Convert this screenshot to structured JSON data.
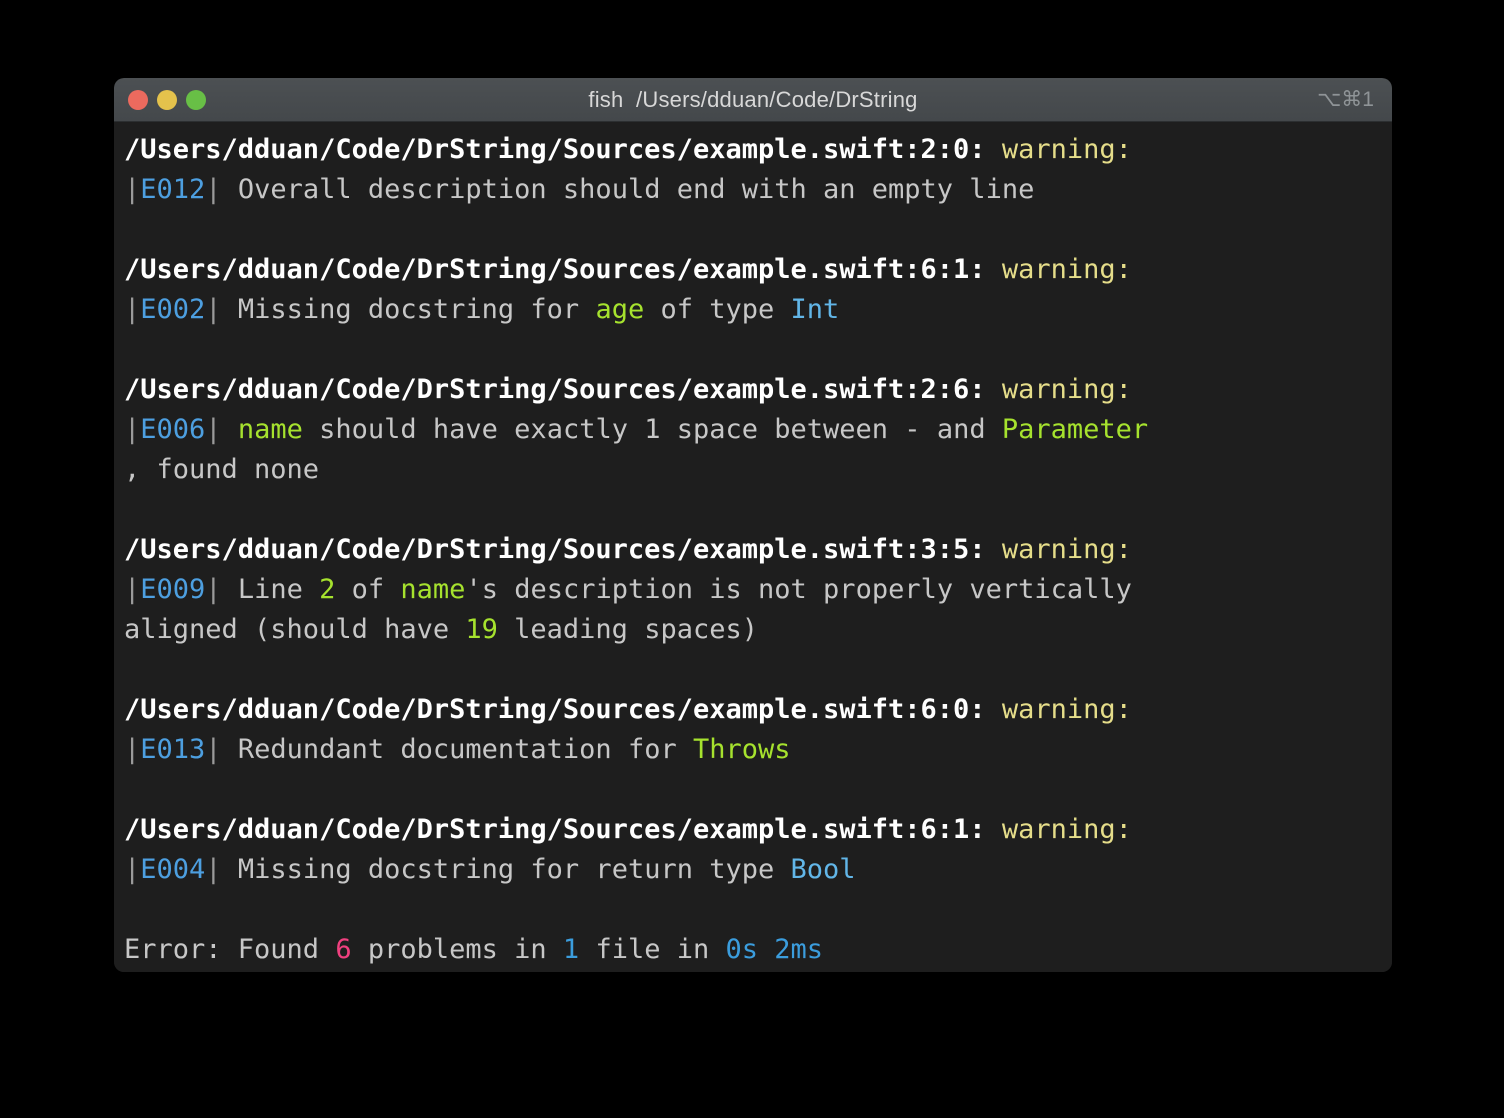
{
  "window": {
    "title": "fish  /Users/dduan/Code/DrString",
    "shortcut": "⌥⌘1",
    "traffic_lights": {
      "close": "close-button",
      "minimize": "minimize-button",
      "zoom": "zoom-button"
    }
  },
  "colors": {
    "background": "#1e1e1e",
    "titlebar": "#474b4e",
    "path": "#ffffff",
    "warning": "#e5dd8a",
    "code": "#4d9fe0",
    "text": "#c7c7c7",
    "green": "#a6e22e",
    "cyan": "#62b6e8",
    "blue": "#3b9ddd",
    "pink": "#f0407f",
    "light_red": "#ec6a5e",
    "light_yellow": "#e4c24c",
    "light_green": "#68bf46"
  },
  "terminal": {
    "diagnostics": [
      {
        "path": "/Users/dduan/Code/DrString/Sources/example.swift:2:0:",
        "severity": "warning:",
        "code": "E012",
        "message_lines": [
          [
            {
              "t": "| ",
              "c": "pipe_open"
            },
            {
              "t": " Overall description should end with an empty line",
              "c": "text"
            }
          ]
        ],
        "message_plain": "|E012| Overall description should end with an empty line"
      },
      {
        "path": "/Users/dduan/Code/DrString/Sources/example.swift:6:1:",
        "severity": "warning:",
        "code": "E002",
        "message_plain": "|E002| Missing docstring for age of type Int"
      },
      {
        "path": "/Users/dduan/Code/DrString/Sources/example.swift:2:6:",
        "severity": "warning:",
        "code": "E006",
        "message_plain": "|E006| name should have exactly 1 space between - and Parameter, found none"
      },
      {
        "path": "/Users/dduan/Code/DrString/Sources/example.swift:3:5:",
        "severity": "warning:",
        "code": "E009",
        "message_plain": "|E009| Line 2 of name's description is not properly vertically aligned (should have 19 leading spaces)"
      },
      {
        "path": "/Users/dduan/Code/DrString/Sources/example.swift:6:0:",
        "severity": "warning:",
        "code": "E013",
        "message_plain": "|E013| Redundant documentation for Throws"
      },
      {
        "path": "/Users/dduan/Code/DrString/Sources/example.swift:6:1:",
        "severity": "warning:",
        "code": "E004",
        "message_plain": "|E004| Missing docstring for return type Bool"
      }
    ],
    "messages": {
      "m1_a": " Overall description should end with an empty line",
      "m2_a": " Missing docstring for ",
      "m2_age": "age",
      "m2_b": " of type ",
      "m2_int": "Int",
      "m3_a": " ",
      "m3_name": "name",
      "m3_b": " should have exactly 1 space between - and ",
      "m3_param": "Parameter",
      "m3_wrap": ", found none",
      "m4_a": " Line ",
      "m4_num": "2",
      "m4_b": " of ",
      "m4_name": "name",
      "m4_c": "'s description is not properly vertically",
      "m4_wrap_a": "aligned (should have ",
      "m4_wrap_num": "19",
      "m4_wrap_b": " leading spaces)",
      "m5_a": " Redundant documentation for ",
      "m5_throws": "Throws",
      "m6_a": " Missing docstring for return type ",
      "m6_bool": "Bool"
    },
    "pipe": "|",
    "summary": {
      "prefix": "Error: Found ",
      "problem_count": "6",
      "middle": " problems in ",
      "file_count": "1",
      "middle2": " file in ",
      "seconds": "0s",
      "space": " ",
      "millis": "2ms",
      "plain": "Error: Found 6 problems in 1 file in 0s 2ms"
    }
  }
}
